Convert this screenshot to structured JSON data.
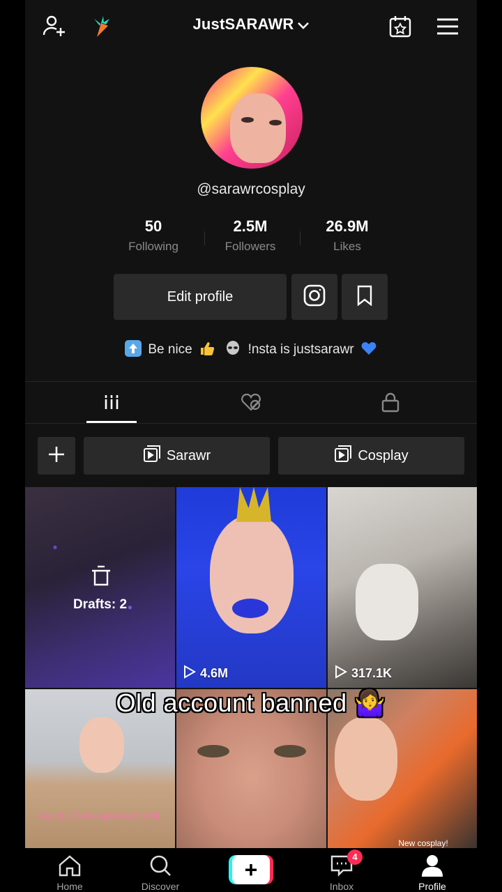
{
  "header": {
    "username": "JustSARAWR",
    "icons": {
      "add_friend": "add-friend-icon",
      "carrot": "carrot-icon",
      "calendar": "calendar-star-icon",
      "menu": "hamburger-menu-icon"
    }
  },
  "profile": {
    "handle": "@sarawrcosplay",
    "stats": [
      {
        "value": "50",
        "label": "Following"
      },
      {
        "value": "2.5M",
        "label": "Followers"
      },
      {
        "value": "26.9M",
        "label": "Likes"
      }
    ],
    "edit_label": "Edit profile",
    "bio_part1": "Be nice",
    "bio_part2": "!nsta is justsarawr"
  },
  "tabs": [
    "videos-tab",
    "liked-tab",
    "private-tab"
  ],
  "playlists": [
    {
      "label": "Sarawr"
    },
    {
      "label": "Cosplay"
    }
  ],
  "grid": {
    "drafts_label": "Drafts: 2",
    "views": [
      "4.6M",
      "317.1K"
    ],
    "overlay_text_1": "My only Tiktok-approved outfit",
    "overlay_text_2": "New cosplay!"
  },
  "caption": "Old account banned 🤷‍♀️",
  "bottom_nav": {
    "items": [
      {
        "label": "Home"
      },
      {
        "label": "Discover"
      },
      {
        "label": "Inbox"
      },
      {
        "label": "Profile"
      }
    ],
    "inbox_badge": "4"
  },
  "colors": {
    "background": "#121212",
    "button": "#2a2a2a",
    "accent_red": "#fe2c55",
    "accent_cyan": "#25f4ee"
  }
}
